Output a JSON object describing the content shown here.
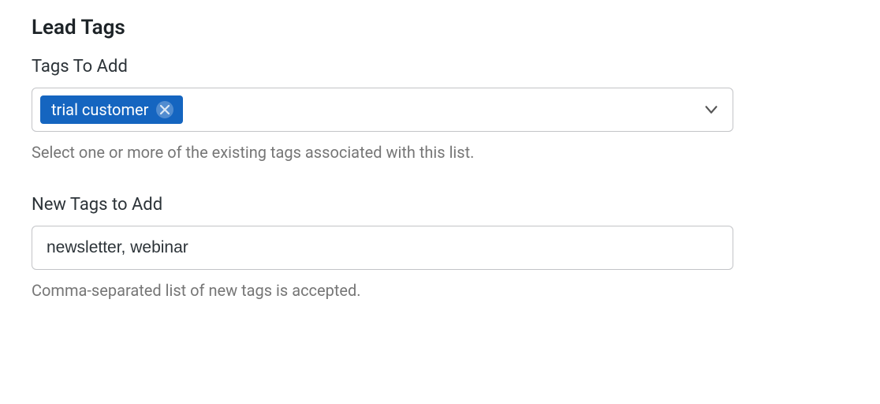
{
  "section": {
    "title": "Lead Tags"
  },
  "tagsToAdd": {
    "label": "Tags To Add",
    "selected": [
      {
        "name": "trial customer"
      }
    ],
    "helper": "Select one or more of the existing tags associated with this list."
  },
  "newTags": {
    "label": "New Tags to Add",
    "value": "newsletter, webinar",
    "helper": "Comma-separated list of new tags is accepted."
  }
}
